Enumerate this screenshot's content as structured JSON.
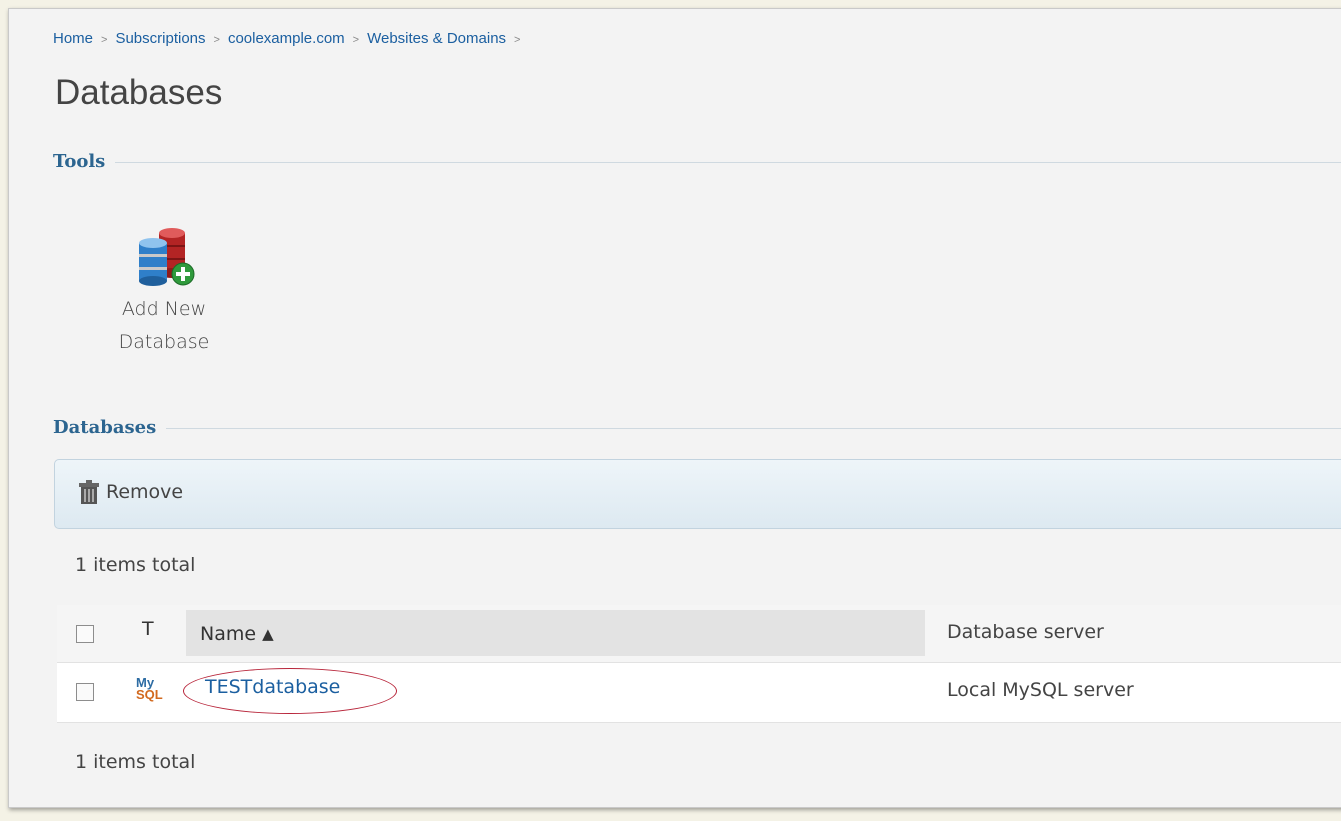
{
  "breadcrumb": {
    "items": [
      "Home",
      "Subscriptions",
      "coolexample.com",
      "Websites & Domains"
    ],
    "separator": ">"
  },
  "page": {
    "title": "Databases"
  },
  "tools_section": {
    "title": "Tools",
    "add_database": {
      "label_line1": "Add New",
      "label_line2": "Database",
      "icon": "add-database-icon"
    }
  },
  "databases_section": {
    "title": "Databases",
    "toolbar": {
      "remove_label": "Remove",
      "icon": "trash-icon"
    },
    "items_total_top": "1 items total",
    "items_total_bottom": "1 items total",
    "columns": {
      "type": "T",
      "name": "Name",
      "sort_indicator": "▲",
      "server": "Database server"
    },
    "rows": [
      {
        "type_icon": "mysql-icon",
        "type_line1": "My",
        "type_line2": "SQL",
        "name": "TESTdatabase",
        "server": "Local MySQL server"
      }
    ]
  },
  "colors": {
    "link": "#1b5fa0",
    "section_title": "#2c6590",
    "annotation_circle": "#b8263b",
    "mysql_blue": "#2d6ca3",
    "mysql_orange": "#d2691e"
  }
}
